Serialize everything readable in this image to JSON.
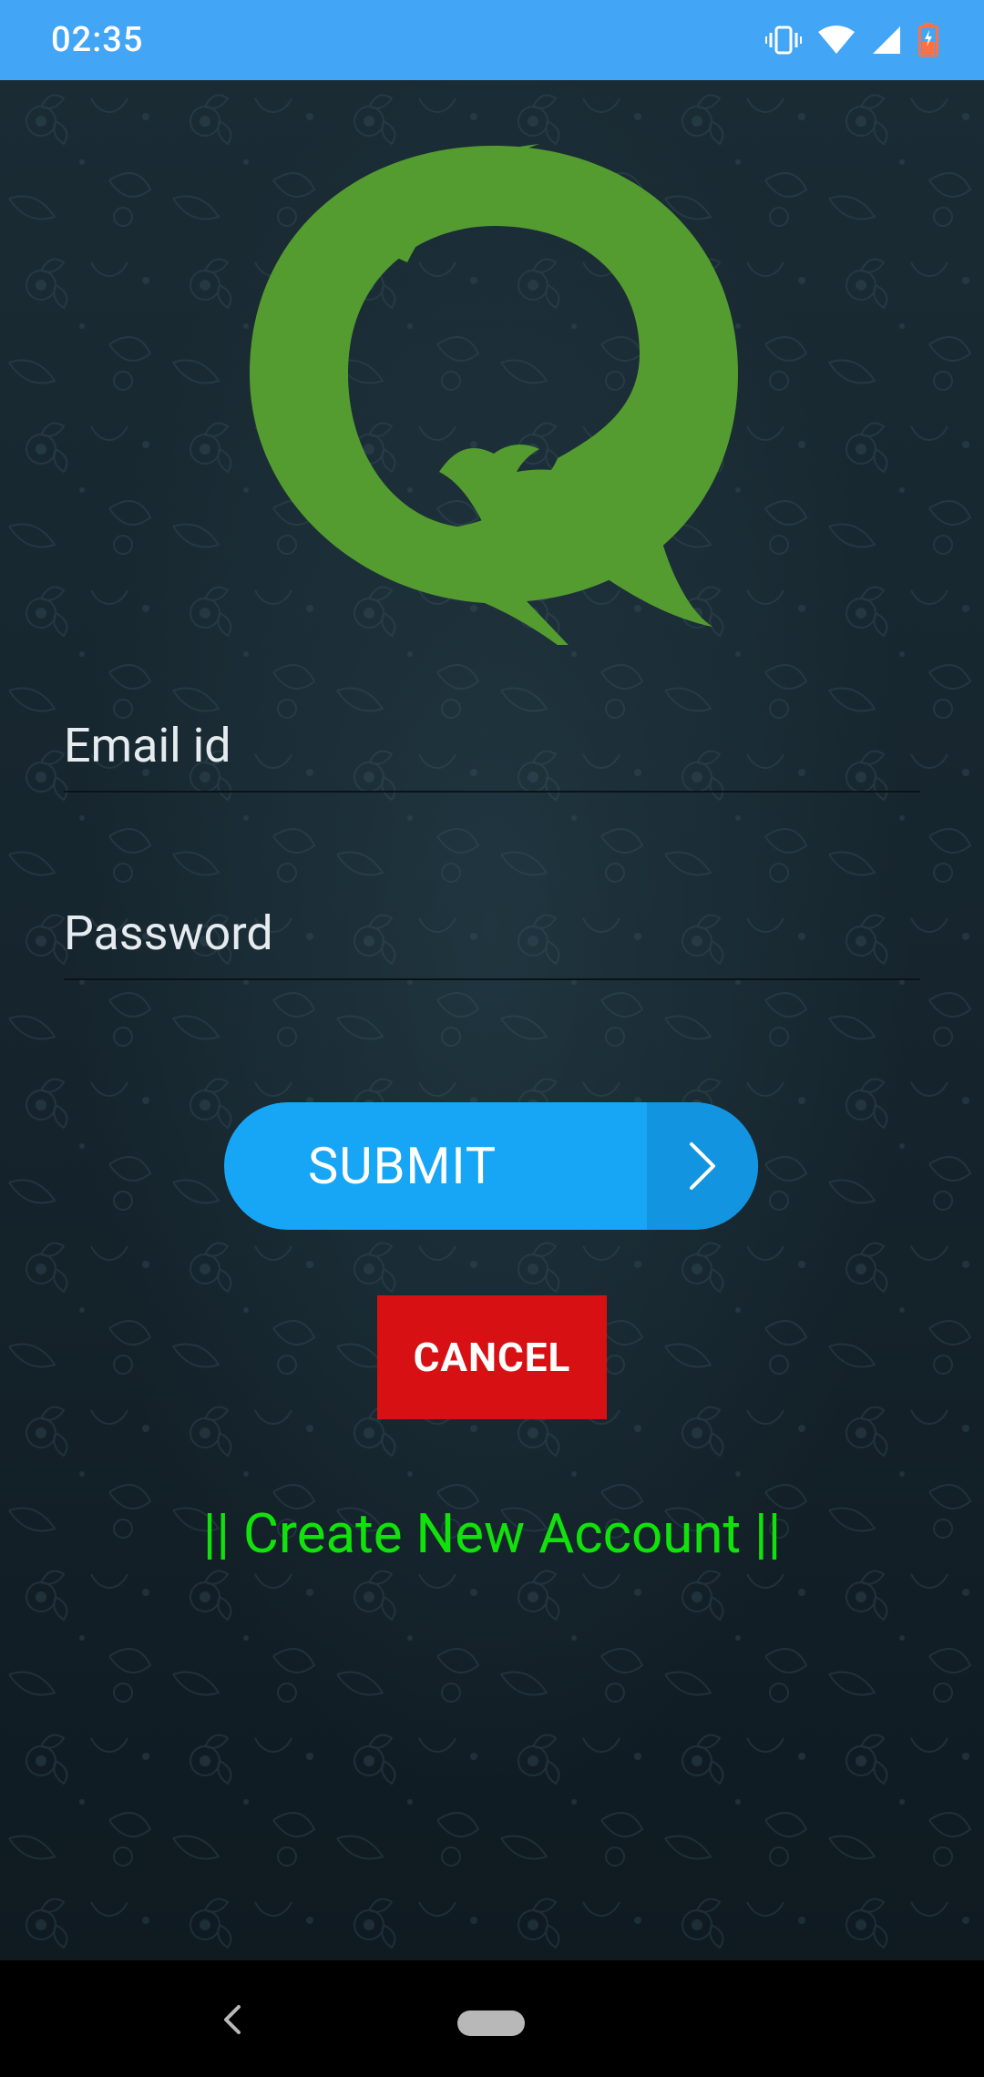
{
  "status_bar": {
    "time": "02:35",
    "icons": [
      "vibrate-icon",
      "wifi-icon",
      "signal-icon",
      "battery-icon"
    ]
  },
  "logo": {
    "icon": "q-bird-logo",
    "color": "#549c30"
  },
  "form": {
    "email_placeholder": "Email id",
    "password_placeholder": "Password",
    "submit_label": "SUBMIT",
    "cancel_label": "CANCEL",
    "create_account_label": "|| Create New Account ||"
  },
  "colors": {
    "status_bar": "#42a5f5",
    "submit": "#16a6f5",
    "cancel": "#d71113",
    "link": "#12e20c"
  },
  "nav_bar": {
    "icons": [
      "back-icon",
      "home-pill-icon"
    ]
  }
}
